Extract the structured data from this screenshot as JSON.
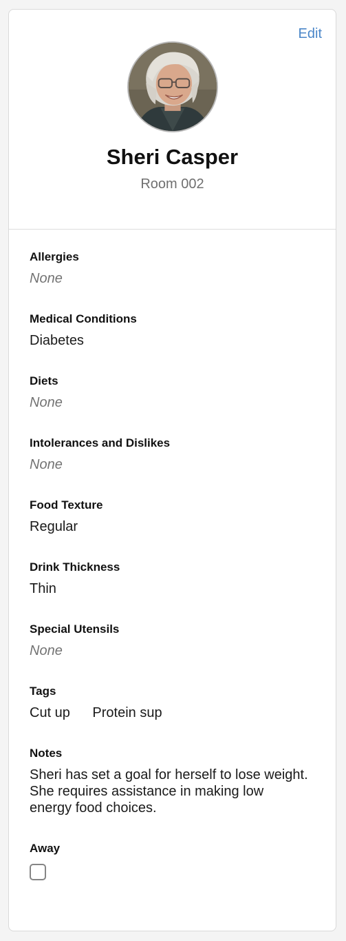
{
  "header": {
    "edit_label": "Edit",
    "resident_name": "Sheri Casper",
    "room": "Room 002"
  },
  "fields": {
    "allergies": {
      "label": "Allergies",
      "value": "None"
    },
    "medical_conditions": {
      "label": "Medical Conditions",
      "value": "Diabetes"
    },
    "diets": {
      "label": "Diets",
      "value": "None"
    },
    "intolerances": {
      "label": "Intolerances and Dislikes",
      "value": "None"
    },
    "food_texture": {
      "label": "Food Texture",
      "value": "Regular"
    },
    "drink_thickness": {
      "label": "Drink Thickness",
      "value": "Thin"
    },
    "special_utensils": {
      "label": "Special Utensils",
      "value": "None"
    },
    "tags": {
      "label": "Tags",
      "items": [
        "Cut up",
        "Protein sup"
      ]
    },
    "notes": {
      "label": "Notes",
      "value": "Sheri has set a goal for herself to lose weight. She requires assistance in making low energy food choices."
    },
    "away": {
      "label": "Away",
      "checked": false
    }
  },
  "colors": {
    "accent": "#4a86c8",
    "muted_text": "#737373",
    "border": "#dcdcdc"
  },
  "icons": {
    "avatar": "resident-photo"
  }
}
